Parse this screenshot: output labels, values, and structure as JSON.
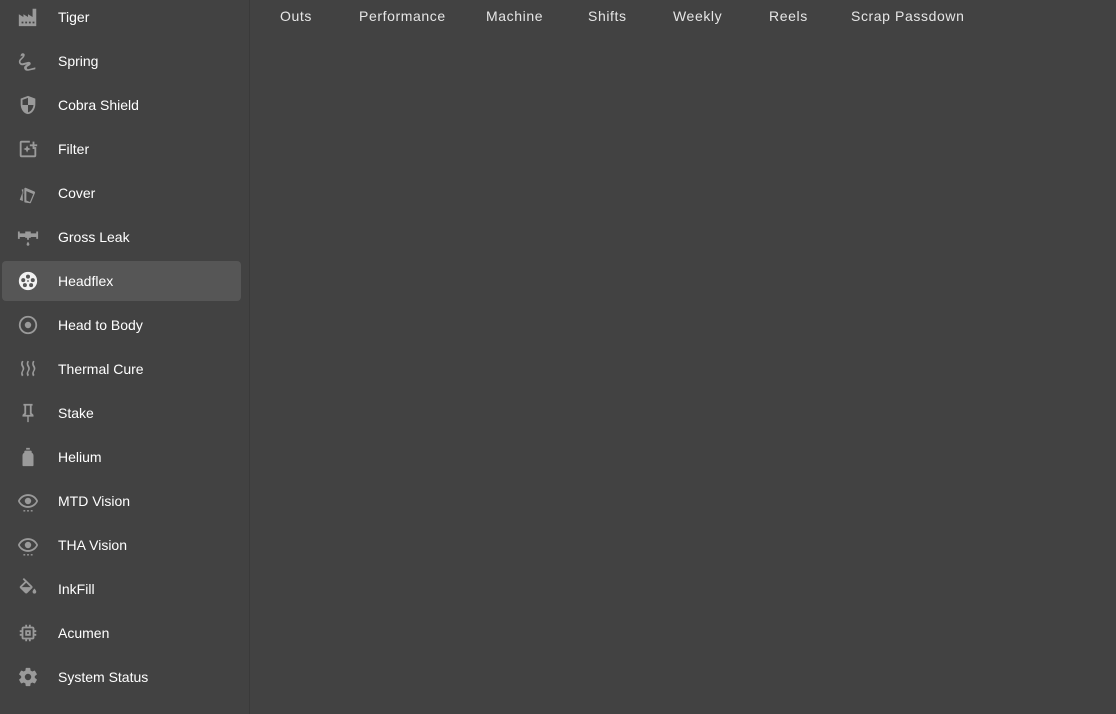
{
  "sidebar": {
    "items": [
      {
        "label": "Tiger",
        "icon": "factory-icon",
        "active": false
      },
      {
        "label": "Spring",
        "icon": "spring-coil-icon",
        "active": false
      },
      {
        "label": "Cobra Shield",
        "icon": "shield-icon",
        "active": false
      },
      {
        "label": "Filter",
        "icon": "filter-sparkle-icon",
        "active": false
      },
      {
        "label": "Cover",
        "icon": "cards-icon",
        "active": false
      },
      {
        "label": "Gross Leak",
        "icon": "pipe-leak-icon",
        "active": false
      },
      {
        "label": "Headflex",
        "icon": "film-reel-icon",
        "active": true
      },
      {
        "label": "Head to Body",
        "icon": "target-circle-icon",
        "active": false
      },
      {
        "label": "Thermal Cure",
        "icon": "heat-waves-icon",
        "active": false
      },
      {
        "label": "Stake",
        "icon": "pushpin-icon",
        "active": false
      },
      {
        "label": "Helium",
        "icon": "gas-bottle-icon",
        "active": false
      },
      {
        "label": "MTD Vision",
        "icon": "eye-icon",
        "active": false
      },
      {
        "label": "THA Vision",
        "icon": "eye-icon",
        "active": false
      },
      {
        "label": "InkFill",
        "icon": "paint-bucket-icon",
        "active": false
      },
      {
        "label": "Acumen",
        "icon": "chip-icon",
        "active": false
      },
      {
        "label": "System Status",
        "icon": "gear-icon",
        "active": false
      }
    ]
  },
  "tabs": [
    {
      "label": "Outs"
    },
    {
      "label": "Performance"
    },
    {
      "label": "Machine"
    },
    {
      "label": "Shifts"
    },
    {
      "label": "Weekly"
    },
    {
      "label": "Reels"
    },
    {
      "label": "Scrap Passdown"
    }
  ],
  "colors": {
    "background": "#424242",
    "active_item": "#565656",
    "icon": "#9a9a9a",
    "text": "#ffffff"
  }
}
